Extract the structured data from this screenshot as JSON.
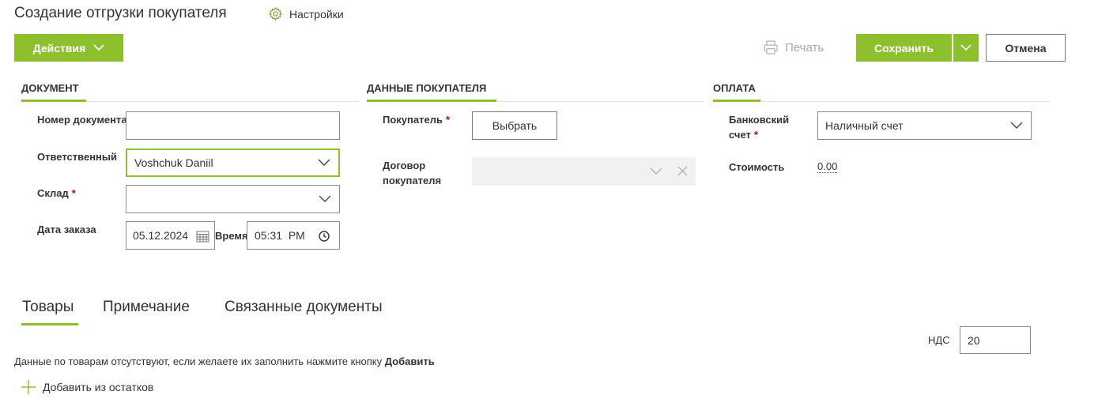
{
  "header": {
    "title": "Создание отгрузки покупателя",
    "settings_label": "Настройки"
  },
  "toolbar": {
    "actions_label": "Действия",
    "print_label": "Печать",
    "save_label": "Сохранить",
    "cancel_label": "Отмена"
  },
  "sections": {
    "document": "ДОКУМЕНТ",
    "customer": "ДАННЫЕ ПОКУПАТЕЛЯ",
    "payment": "ОПЛАТА"
  },
  "document": {
    "number_label": "Номер документа",
    "number_value": "",
    "responsible_label": "Ответственный",
    "responsible_value": "Voshchuk Daniil",
    "warehouse_label": "Склад",
    "warehouse_value": "",
    "order_date_label": "Дата заказа",
    "order_date_value": "05.12.2024",
    "time_label": "Время",
    "time_value": "05:31  PM"
  },
  "customer": {
    "customer_label": "Покупатель",
    "select_button": "Выбрать",
    "contract_label_line1": "Договор",
    "contract_label_line2": "покупателя",
    "contract_value": ""
  },
  "payment": {
    "bank_label_line1": "Банковский",
    "bank_label_line2": "счет",
    "bank_value": "Наличный счет",
    "cost_label": "Стоимость",
    "cost_value": "0.00"
  },
  "tabs": [
    {
      "label": "Товары",
      "active": true
    },
    {
      "label": "Примечание",
      "active": false
    },
    {
      "label": "Связанные документы",
      "active": false
    }
  ],
  "products": {
    "vat_label": "НДС",
    "vat_value": "20",
    "empty_message": "Данные по товарам отсутствуют, если желаете их заполнить нажмите кнопку",
    "empty_message_action": "Добавить",
    "add_from_stock": "Добавить из остатков"
  },
  "colors": {
    "accent": "#8dc02d",
    "required": "#cc0000",
    "disabled_bg": "#f1f1f1"
  }
}
